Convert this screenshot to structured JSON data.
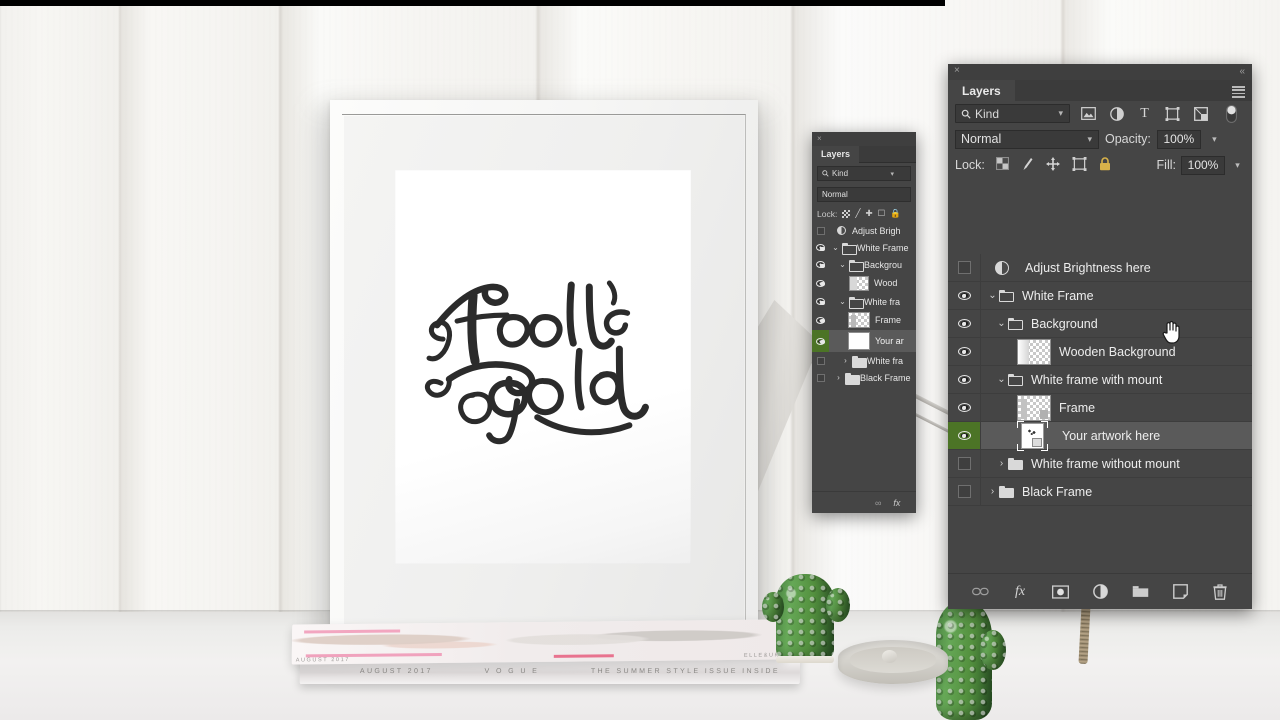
{
  "scene": {
    "artwork_title": "Fool's Gold",
    "magazines": {
      "top_left_label": "AUGUST 2017",
      "top_right_label": "ELLE&UK",
      "bottom_left_label": "AUGUST 2017",
      "bottom_center_label": "V O G U E",
      "bottom_right_label": "THE SUMMER STYLE ISSUE INSIDE"
    }
  },
  "panel_small": {
    "title": "Layers",
    "close_icon": "×",
    "kind_label": "Kind",
    "blend_mode": "Normal",
    "lock_label": "Lock:",
    "rows": [
      {
        "name": "Adjust Brigh"
      },
      {
        "name": "White Frame"
      },
      {
        "name": "Backgrou"
      },
      {
        "name": "Wood"
      },
      {
        "name": "White fra"
      },
      {
        "name": "Frame"
      },
      {
        "name": "Your ar"
      },
      {
        "name": "White fra"
      },
      {
        "name": "Black Frame"
      }
    ],
    "footer_icons": [
      "link-icon",
      "fx-icon"
    ]
  },
  "panel_main": {
    "close_icon": "×",
    "collapse_icon": "«",
    "tab_label": "Layers",
    "menu_icon": "panel-menu-icon",
    "filter": {
      "kind_label": "Kind",
      "search_icon": "search-icon",
      "chevron": "⌄",
      "icons": [
        "pixel-layer-filter-icon",
        "adjustment-layer-filter-icon",
        "type-layer-filter-icon",
        "shape-layer-filter-icon",
        "smart-object-filter-icon",
        "filter-toggle-switch"
      ]
    },
    "blend": {
      "mode": "Normal",
      "chevron": "⌄",
      "opacity_label": "Opacity:",
      "opacity_value": "100%",
      "opacity_chevron": "⌄"
    },
    "lock": {
      "label": "Lock:",
      "icons": [
        "lock-transparent-pixels-icon",
        "lock-image-pixels-icon",
        "lock-position-icon",
        "lock-artboard-nesting-icon",
        "lock-all-icon"
      ],
      "fill_label": "Fill:",
      "fill_value": "100%",
      "fill_chevron": "⌄"
    },
    "layers": [
      {
        "name": "Adjust Brightness here",
        "visible": false,
        "type": "adjustment",
        "indent": 0,
        "twisty": "",
        "selected": false
      },
      {
        "name": "White Frame",
        "visible": true,
        "type": "group",
        "indent": 0,
        "twisty": "⌄",
        "selected": false
      },
      {
        "name": "Background",
        "visible": true,
        "type": "group",
        "indent": 1,
        "twisty": "⌄",
        "selected": false
      },
      {
        "name": "Wooden Background",
        "visible": true,
        "type": "thumb-wood",
        "indent": 2,
        "twisty": "",
        "selected": false
      },
      {
        "name": "White frame with mount",
        "visible": true,
        "type": "group",
        "indent": 1,
        "twisty": "⌄",
        "selected": false
      },
      {
        "name": "Frame",
        "visible": true,
        "type": "thumb-frame",
        "indent": 2,
        "twisty": "",
        "selected": false
      },
      {
        "name": "Your artwork here",
        "visible": true,
        "type": "thumb-smart",
        "indent": 2,
        "twisty": "",
        "selected": true
      },
      {
        "name": "White frame without mount",
        "visible": false,
        "type": "group-solid",
        "indent": 1,
        "twisty": "›",
        "selected": false
      },
      {
        "name": "Black Frame",
        "visible": false,
        "type": "group-solid",
        "indent": 0,
        "twisty": "›",
        "selected": false
      }
    ],
    "footer": {
      "icons": [
        "link-layers-icon",
        "add-layer-style-icon",
        "add-layer-mask-icon",
        "new-adjustment-layer-icon",
        "new-group-icon",
        "new-layer-icon",
        "delete-layer-icon"
      ],
      "fx_label": "fx"
    }
  },
  "colors": {
    "panel_bg": "#454545",
    "field_bg": "#3a3a3a",
    "selected_row": "#5a5a5a",
    "visibility_highlight": "#4c7426",
    "text": "#ededed"
  }
}
